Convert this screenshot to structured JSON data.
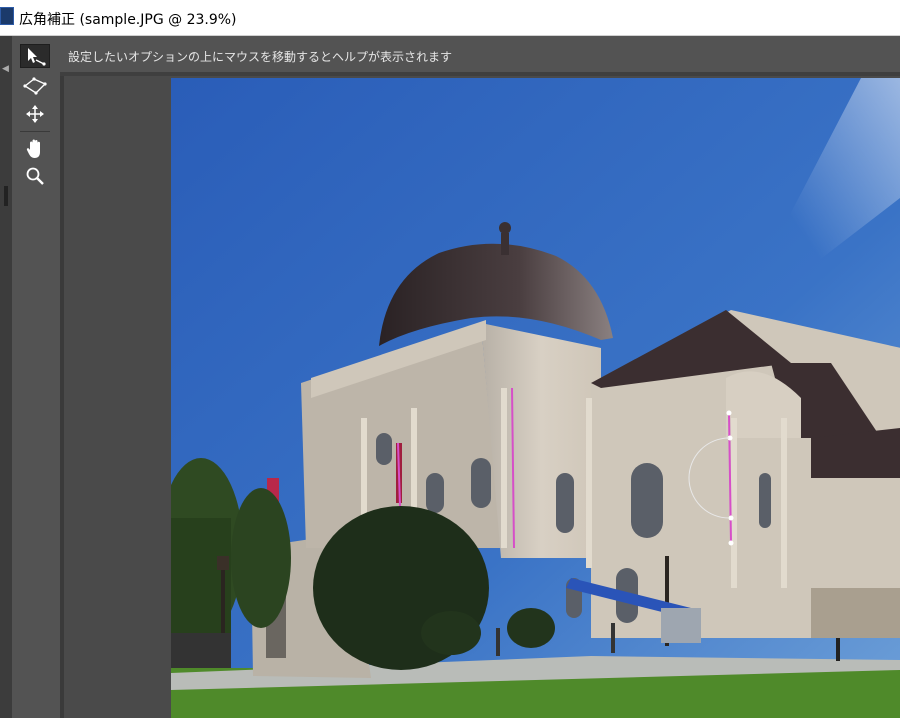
{
  "window": {
    "title": "広角補正 (sample.JPG @ 23.9%)"
  },
  "help": {
    "text": "設定したいオプションの上にマウスを移動するとヘルプが表示されます"
  },
  "toolbar": {
    "tools": [
      {
        "name": "constraint-tool",
        "icon": "arrow-line-icon",
        "active": true
      },
      {
        "name": "polygon-constraint-tool",
        "icon": "polygon-icon",
        "active": false
      },
      {
        "name": "move-tool",
        "icon": "move-icon",
        "active": false
      },
      {
        "name": "hand-tool",
        "icon": "hand-icon",
        "active": false
      },
      {
        "name": "zoom-tool",
        "icon": "zoom-icon",
        "active": false
      }
    ]
  },
  "colors": {
    "panel": "#535353",
    "canvas": "#4a4a4a",
    "sky": "#2f64b8",
    "constraint": "#d64fc8"
  }
}
